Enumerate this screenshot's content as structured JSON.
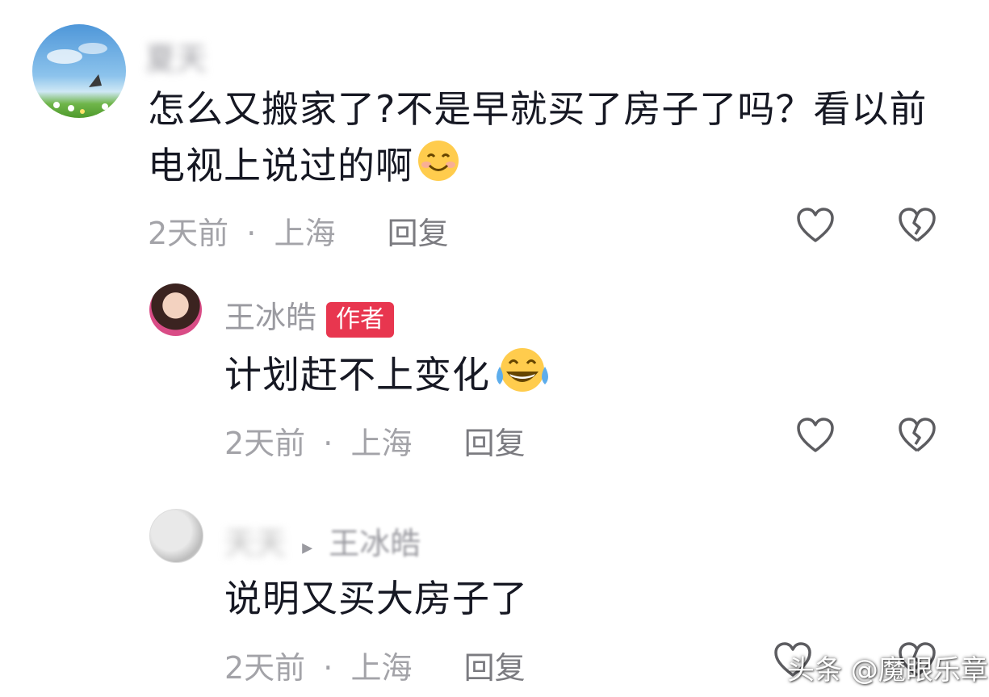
{
  "comments": [
    {
      "author": "夏天",
      "text": "怎么又搬家了?不是早就买了房子了吗？看以前电视上说过的啊",
      "emoji": "smile",
      "time": "2天前",
      "location": "上海",
      "reply_label": "回复",
      "like_icon": "heart-icon",
      "dislike_icon": "broken-heart-icon"
    },
    {
      "author": "王冰皓",
      "badge": "作者",
      "text": "计划赶不上变化",
      "emoji": "laugh-cry",
      "time": "2天前",
      "location": "上海",
      "reply_label": "回复",
      "like_icon": "heart-icon",
      "dislike_icon": "broken-heart-icon"
    },
    {
      "author": "天天",
      "reply_to_arrow": "▸",
      "reply_to": "王冰皓",
      "text": "说明又买大房子了",
      "time": "2天前",
      "location": "上海",
      "reply_label": "回复",
      "like_icon": "heart-icon",
      "dislike_icon": "broken-heart-icon"
    }
  ],
  "separator": "·",
  "watermark": "头条 @魔眼乐章",
  "colors": {
    "badge": "#e8364f",
    "meta": "#a3a3a8",
    "text": "#161823"
  }
}
